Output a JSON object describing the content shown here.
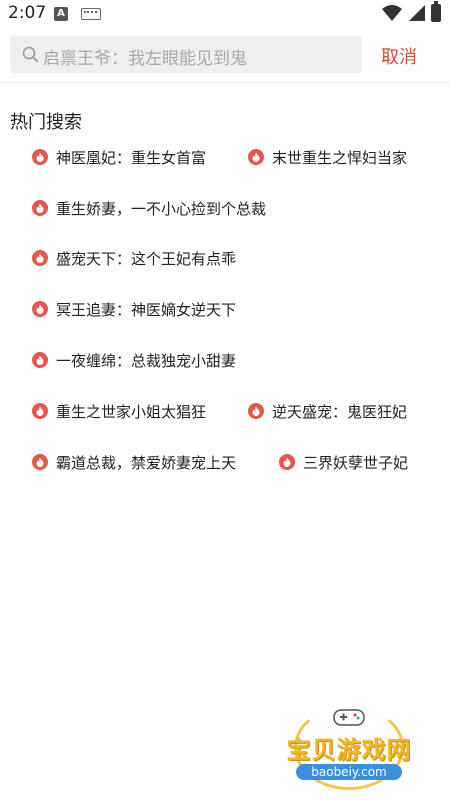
{
  "status_bar": {
    "time": "2:07",
    "notif_icon_letter": "A"
  },
  "search": {
    "placeholder_icon": "search-icon",
    "text": "启禀王爷：我左眼能见到鬼"
  },
  "cancel_label": "取消",
  "hot_section": {
    "title": "热门搜索",
    "items": [
      "神医凰妃：重生女首富",
      "末世重生之悍妇当家",
      "重生娇妻，一不小心捡到个总裁",
      "盛宠天下：这个王妃有点乖",
      "冥王追妻：神医嫡女逆天下",
      "一夜缠绵：总裁独宠小甜妻",
      "重生之世家小姐太猖狂",
      "逆天盛宠：鬼医狂妃",
      "霸道总裁，禁爱娇妻宠上天",
      "三界妖孽世子妃"
    ]
  },
  "watermark": {
    "text": "宝贝游戏网",
    "url": "baobeiy.com"
  },
  "colors": {
    "accent": "#d84a3a",
    "fire_icon": "#e8554a",
    "search_bg": "#efefef",
    "placeholder": "#a8a8a8"
  }
}
